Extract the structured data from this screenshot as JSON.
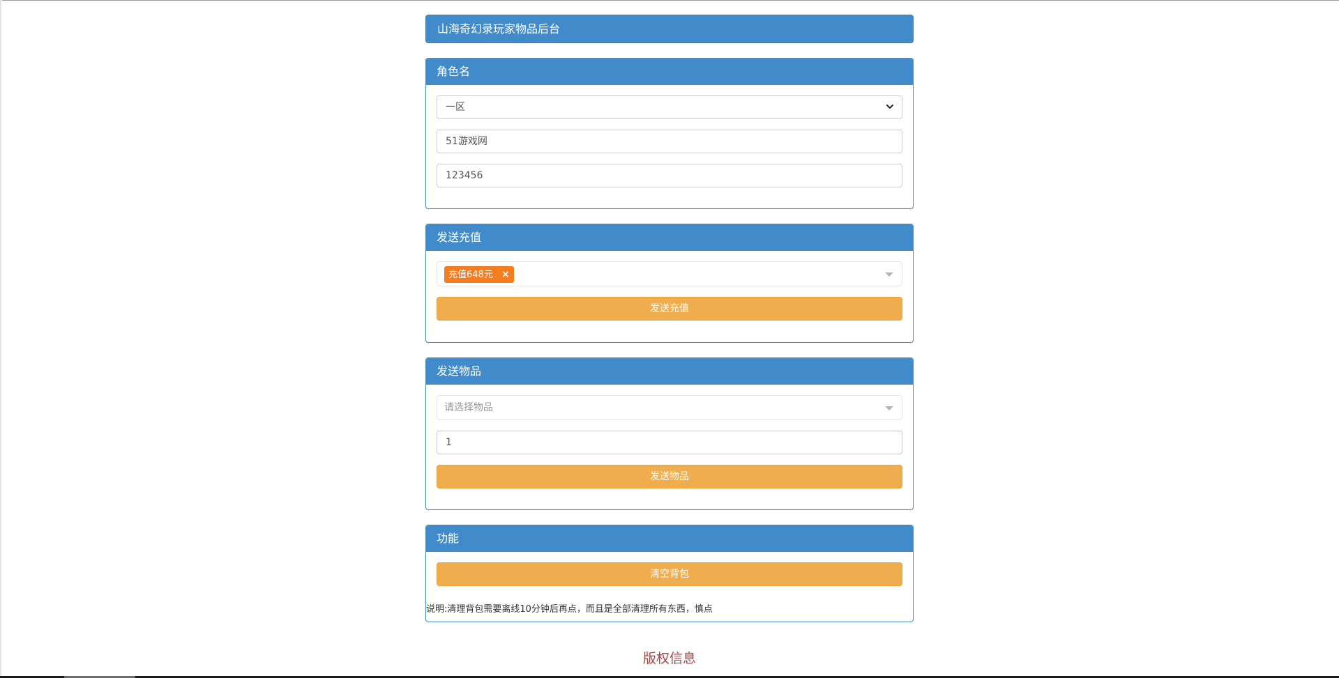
{
  "header": {
    "title": "山海奇幻录玩家物品后台"
  },
  "role_panel": {
    "heading": "角色名",
    "server_select": {
      "selected": "一区"
    },
    "account_input": {
      "value": "51游戏网"
    },
    "password_input": {
      "value": "123456"
    }
  },
  "recharge_panel": {
    "heading": "发送充值",
    "selected_tag": "充值648元",
    "tag_remove": "×",
    "button_label": "发送充值"
  },
  "item_panel": {
    "heading": "发送物品",
    "item_select_placeholder": "请选择物品",
    "quantity_input": {
      "value": "1"
    },
    "button_label": "发送物品"
  },
  "function_panel": {
    "heading": "功能",
    "clear_button_label": "清空背包",
    "note": "说明:清理背包需要离线10分钟后再点，而且是全部清理所有东西，慎点"
  },
  "footer": {
    "copyright": "版权信息"
  },
  "colors": {
    "primary": "#428bca",
    "warning": "#f0ad4e",
    "tag": "#f57c1f",
    "copyright": "#a94442"
  }
}
